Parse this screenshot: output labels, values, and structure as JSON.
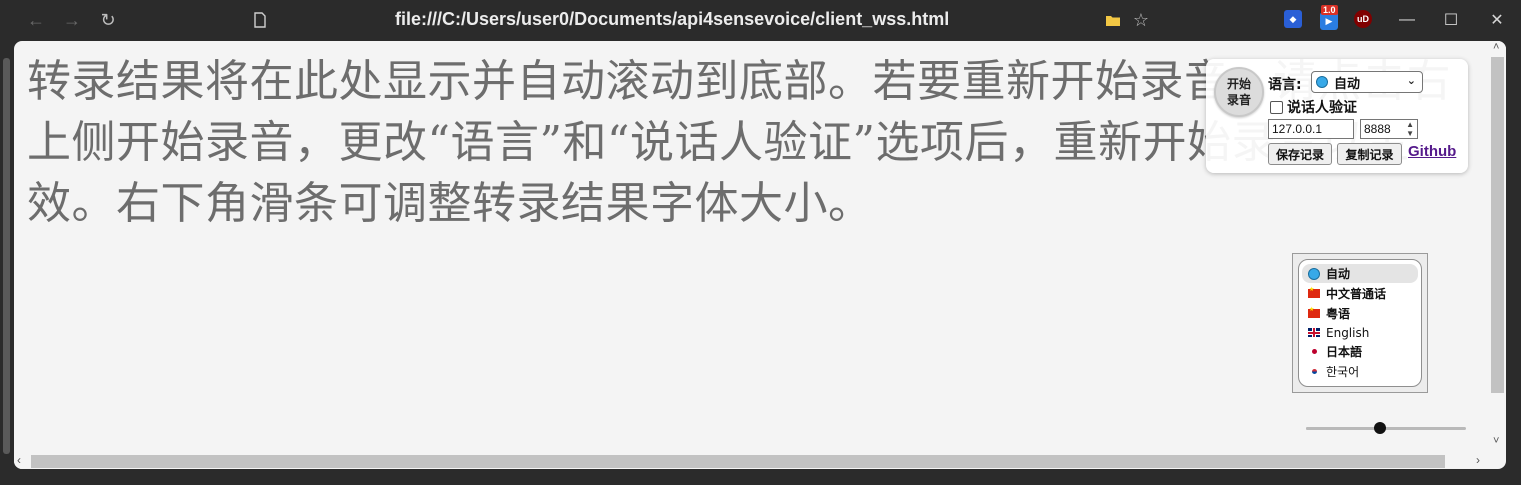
{
  "browser": {
    "url": "file:///C:/Users/user0/Documents/api4sensevoice/client_wss.html",
    "extension_badge": "1.0",
    "ublock_label": "uD",
    "accent_color": "#2b2b2b"
  },
  "transcript": {
    "text": "转录结果将在此处显示并自动滚动到底部。若要重新开始录音，请点击右上侧开始录音，更改“语言”和“说话人验证”选项后，重新开始录音以生效。右下角滑条可调整转录结果字体大小。"
  },
  "panel": {
    "record_button_label": "开始录音",
    "language_label": "语言:",
    "language_selected": "自动",
    "speaker_verify_label": "说话人验证",
    "speaker_verify_checked": false,
    "host_value": "127.0.0.1",
    "port_value": "8888",
    "save_button": "保存记录",
    "copy_button": "复制记录",
    "github_link": "Github"
  },
  "language_dropdown": {
    "options": [
      {
        "label": "自动",
        "icon": "globe-icon",
        "bold": true,
        "selected": true
      },
      {
        "label": "中文普通话",
        "icon": "china-flag-icon",
        "bold": true,
        "selected": false
      },
      {
        "label": "粤语",
        "icon": "china-flag-icon",
        "bold": true,
        "selected": false
      },
      {
        "label": "English",
        "icon": "uk-flag-icon",
        "bold": false,
        "selected": false
      },
      {
        "label": "日本語",
        "icon": "japan-flag-icon",
        "bold": true,
        "selected": false
      },
      {
        "label": "한국어",
        "icon": "korea-flag-icon",
        "bold": false,
        "selected": false
      }
    ]
  },
  "font_slider": {
    "value_fraction": 0.46
  }
}
